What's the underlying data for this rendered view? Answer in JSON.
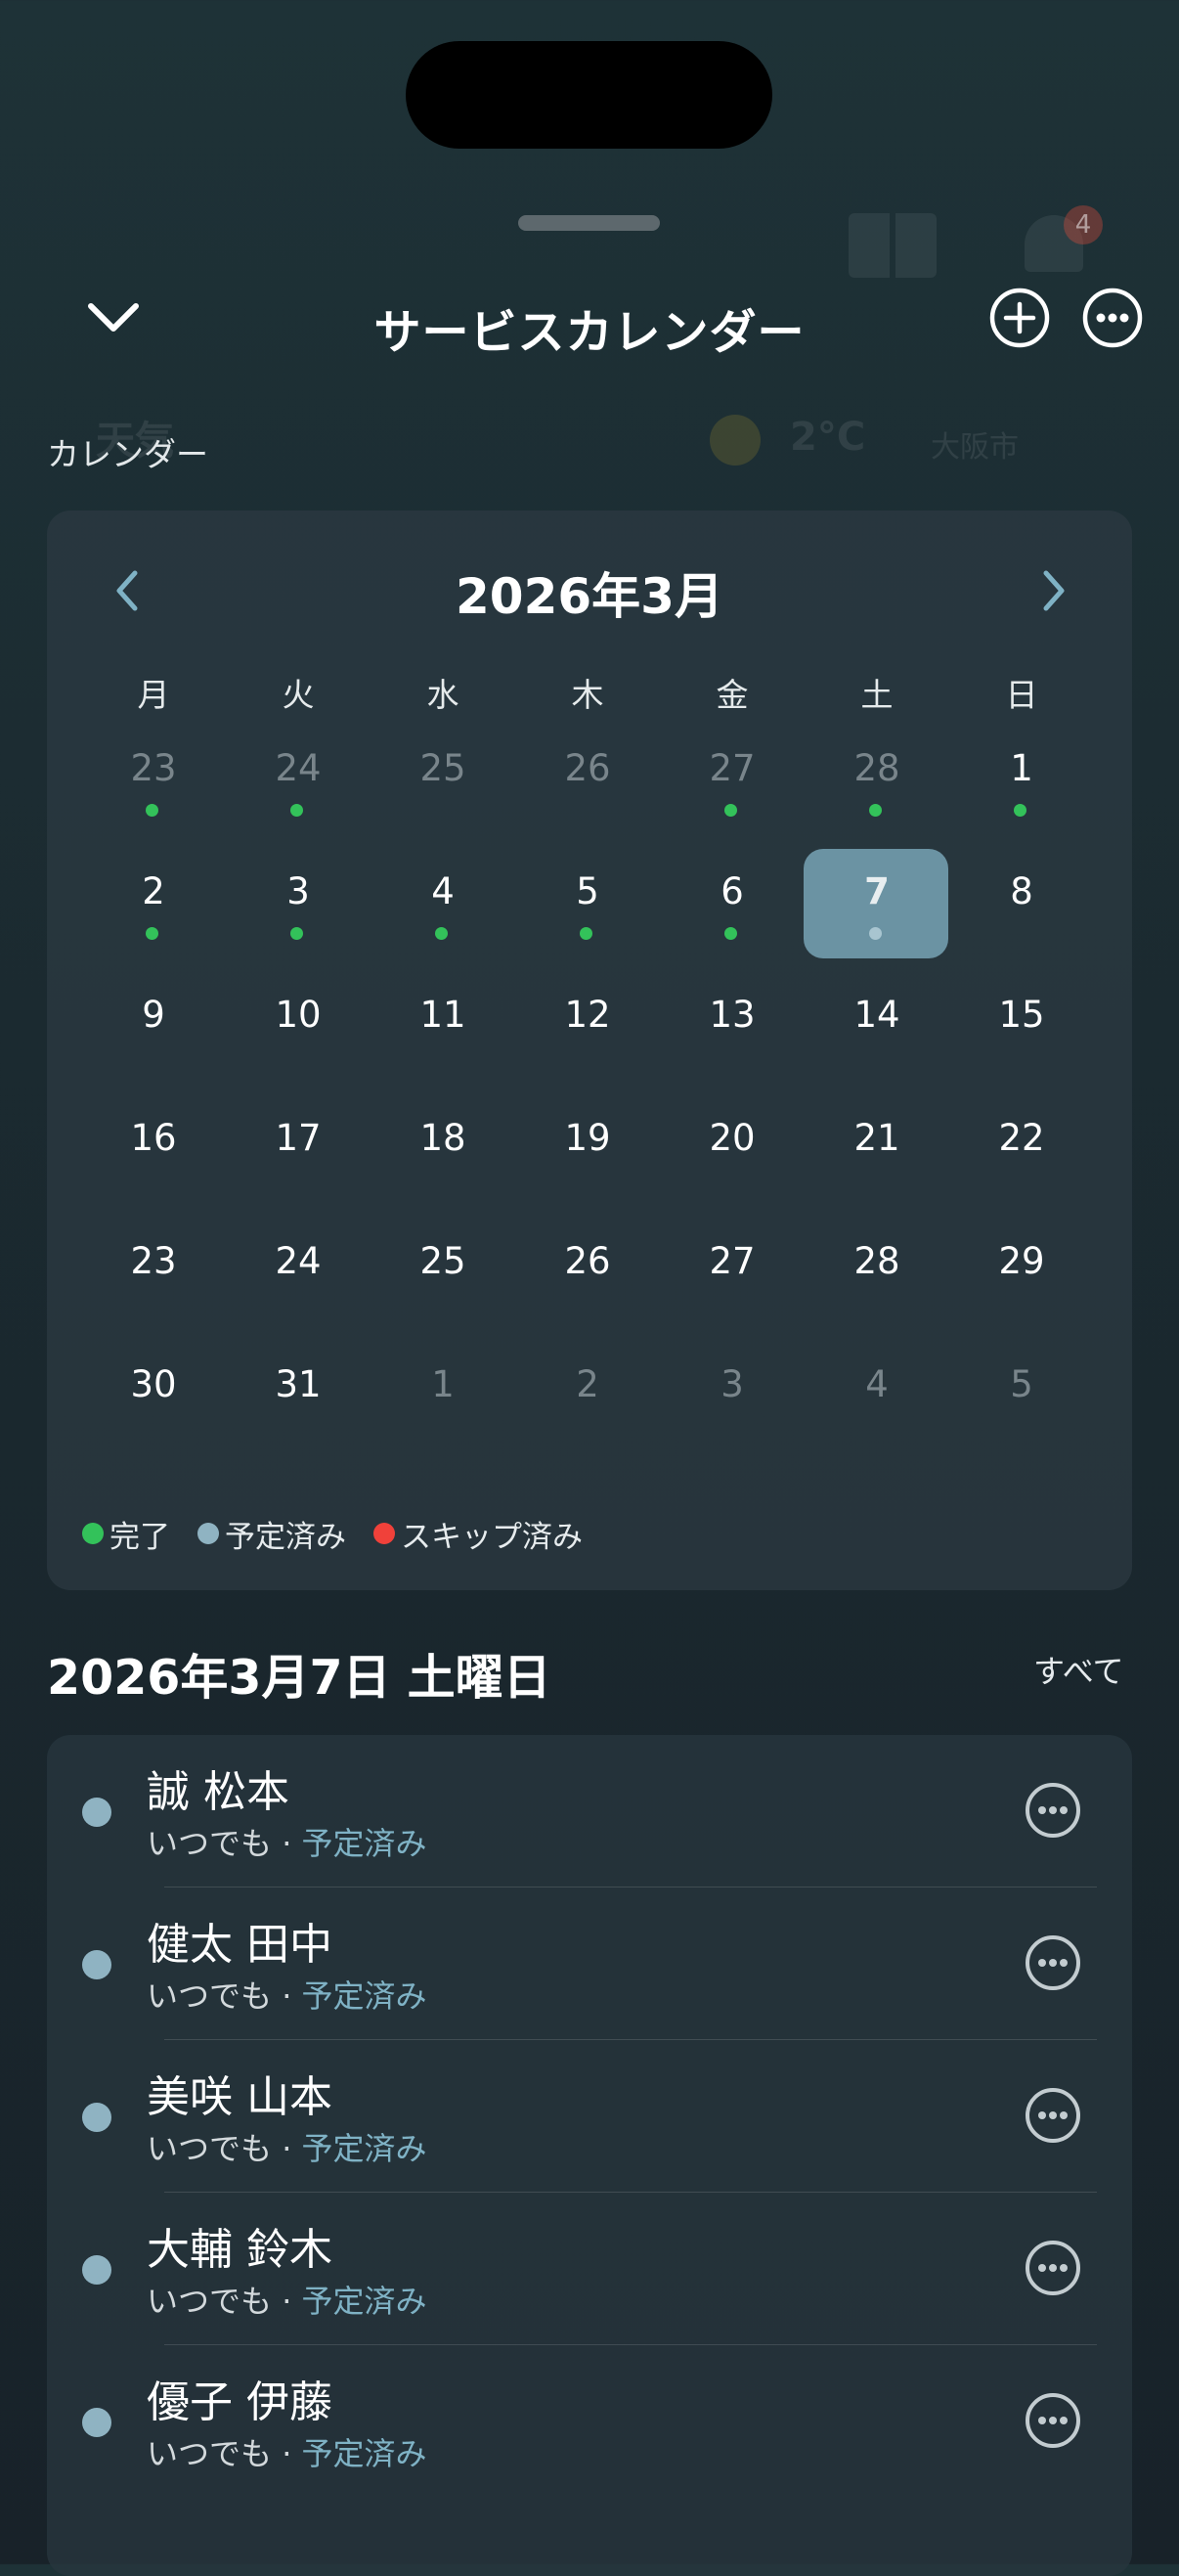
{
  "header": {
    "title": "サービスカレンダー"
  },
  "background": {
    "weather_label": "天気",
    "temperature": "2°C",
    "city": "大阪市",
    "bell_badge": "4"
  },
  "calendar": {
    "section_label": "カレンダー",
    "month_title": "2026年3月",
    "weekdays": [
      "月",
      "火",
      "水",
      "木",
      "金",
      "土",
      "日"
    ],
    "weeks": [
      [
        {
          "d": "23",
          "m": true,
          "done": true
        },
        {
          "d": "24",
          "m": true,
          "done": true
        },
        {
          "d": "25",
          "m": true
        },
        {
          "d": "26",
          "m": true
        },
        {
          "d": "27",
          "m": true,
          "done": true
        },
        {
          "d": "28",
          "m": true,
          "done": true
        },
        {
          "d": "1",
          "done": true
        }
      ],
      [
        {
          "d": "2",
          "done": true
        },
        {
          "d": "3",
          "done": true
        },
        {
          "d": "4",
          "done": true
        },
        {
          "d": "5",
          "done": true
        },
        {
          "d": "6",
          "done": true
        },
        {
          "d": "7",
          "selected": true,
          "scheduled": true
        },
        {
          "d": "8"
        }
      ],
      [
        {
          "d": "9"
        },
        {
          "d": "10"
        },
        {
          "d": "11"
        },
        {
          "d": "12"
        },
        {
          "d": "13"
        },
        {
          "d": "14"
        },
        {
          "d": "15"
        }
      ],
      [
        {
          "d": "16"
        },
        {
          "d": "17"
        },
        {
          "d": "18"
        },
        {
          "d": "19"
        },
        {
          "d": "20"
        },
        {
          "d": "21"
        },
        {
          "d": "22"
        }
      ],
      [
        {
          "d": "23"
        },
        {
          "d": "24"
        },
        {
          "d": "25"
        },
        {
          "d": "26"
        },
        {
          "d": "27"
        },
        {
          "d": "28"
        },
        {
          "d": "29"
        }
      ],
      [
        {
          "d": "30"
        },
        {
          "d": "31"
        },
        {
          "d": "1",
          "m": true
        },
        {
          "d": "2",
          "m": true
        },
        {
          "d": "3",
          "m": true
        },
        {
          "d": "4",
          "m": true
        },
        {
          "d": "5",
          "m": true
        }
      ]
    ],
    "legend": [
      {
        "label": "完了",
        "color": "#33c25a"
      },
      {
        "label": "予定済み",
        "color": "#8fb3c2"
      },
      {
        "label": "スキップ済み",
        "color": "#f0413a"
      }
    ]
  },
  "selected_day": {
    "heading": "2026年3月7日 土曜日",
    "see_all": "すべて",
    "appointments": [
      {
        "name": "誠 松本",
        "time": "いつでも",
        "separator": " · ",
        "status": "予定済み"
      },
      {
        "name": "健太 田中",
        "time": "いつでも",
        "separator": " · ",
        "status": "予定済み"
      },
      {
        "name": "美咲 山本",
        "time": "いつでも",
        "separator": " · ",
        "status": "予定済み"
      },
      {
        "name": "大輔 鈴木",
        "time": "いつでも",
        "separator": " · ",
        "status": "予定済み"
      },
      {
        "name": "優子 伊藤",
        "time": "いつでも",
        "separator": " · ",
        "status": "予定済み"
      }
    ]
  },
  "colors": {
    "completed": "#33c25a",
    "scheduled": "#8fb3c2",
    "skipped": "#f0413a",
    "selected_bg": "#6b93a3"
  }
}
